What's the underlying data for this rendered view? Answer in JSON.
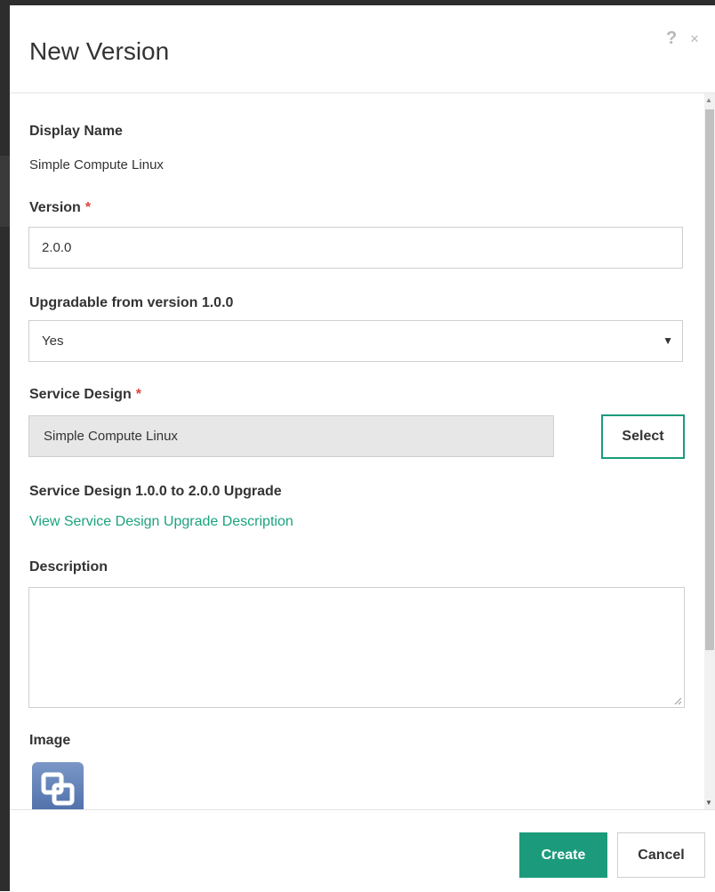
{
  "dialog": {
    "title": "New Version",
    "help_icon": "?",
    "close_icon": "×"
  },
  "form": {
    "display_name": {
      "label": "Display Name",
      "value": "Simple Compute Linux"
    },
    "version": {
      "label": "Version",
      "required_mark": "*",
      "value": "2.0.0"
    },
    "upgradable": {
      "label": "Upgradable from version 1.0.0",
      "selected": "Yes",
      "caret": "▼"
    },
    "service_design": {
      "label": "Service Design",
      "required_mark": "*",
      "value": "Simple Compute Linux",
      "select_label": "Select"
    },
    "upgrade_section": {
      "label": "Service Design 1.0.0 to 2.0.0 Upgrade",
      "link": "View Service Design Upgrade Description"
    },
    "description": {
      "label": "Description",
      "value": ""
    },
    "image": {
      "label": "Image",
      "icon": "service-design-icon"
    }
  },
  "footer": {
    "create_label": "Create",
    "cancel_label": "Cancel"
  },
  "colors": {
    "accent": "#1c9b7c",
    "link": "#1aa37d",
    "required": "#e0433a"
  }
}
